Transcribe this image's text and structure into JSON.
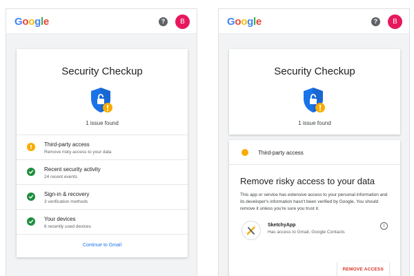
{
  "brand": {
    "name": "Google",
    "letter_colors": [
      "#4285f4",
      "#ea4335",
      "#fbbc05",
      "#4285f4",
      "#34a853",
      "#ea4335"
    ]
  },
  "header": {
    "help_icon": "help-icon",
    "avatar_letter": "B",
    "avatar_color": "#e8175d"
  },
  "left": {
    "title": "Security Checkup",
    "issues": "1 issue found",
    "items": [
      {
        "title": "Third-party access",
        "subtitle": "Remove risky access to your data",
        "status": "warning"
      },
      {
        "title": "Recent security activity",
        "subtitle": "24 recent events",
        "status": "ok"
      },
      {
        "title": "Sign-in & recovery",
        "subtitle": "3 verification methods",
        "status": "ok"
      },
      {
        "title": "Your devices",
        "subtitle": "6 recently used devices",
        "status": "ok"
      }
    ],
    "link": "Continue to Gmail"
  },
  "right": {
    "title": "Security Checkup",
    "issues": "1 issue found",
    "section_label": "Third-party access",
    "heading": "Remove risky access to your data",
    "body": "This app or service has extensive access to your personal information and its developer's information hasn't been verified by Google. You should remove it unless you're sure you trust it.",
    "app_name": "SketchyApp",
    "app_access": "Has access to Gmail, Google Contacts",
    "button": "REMOVE ACCESS"
  },
  "colors": {
    "warning": "#f9ab00",
    "ok": "#1e8e3e",
    "shield": "#1a73e8",
    "link": "#1a73e8",
    "danger": "#d93025"
  }
}
